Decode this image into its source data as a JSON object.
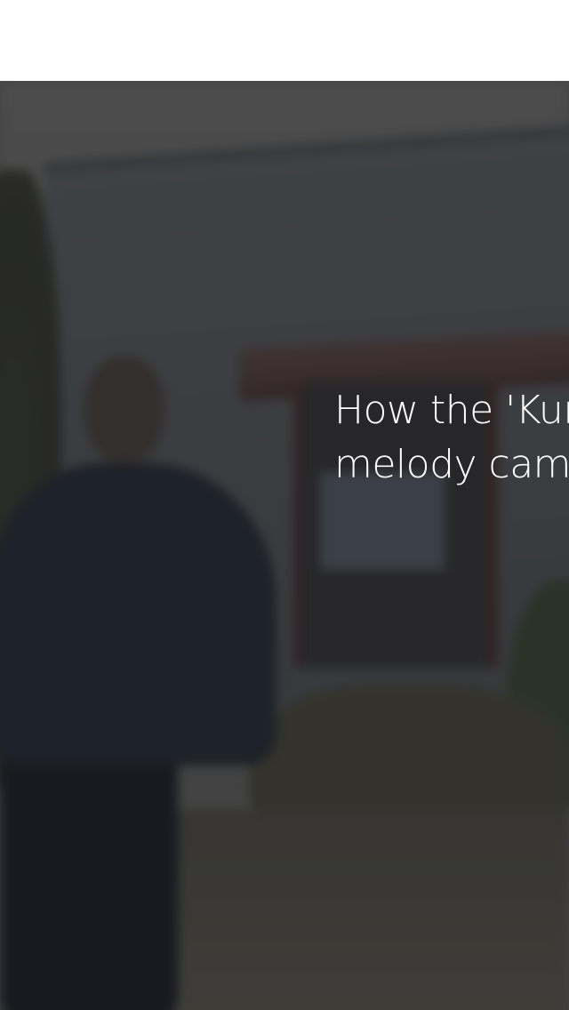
{
  "article": {
    "headline": "How the 'Kum melody came Asia"
  },
  "colors": {
    "top_bar": "#ffffff",
    "headline_text": "#ffffff",
    "hero_tint": "#4f4f4f"
  }
}
